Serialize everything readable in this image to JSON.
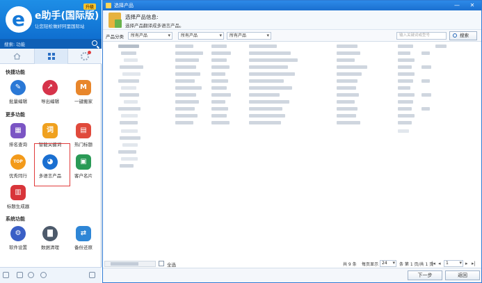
{
  "app": {
    "brand_title": "e助手(国际版)",
    "brand_badge": "升级",
    "brand_subtitle": "让您轻松做好阿里国际站",
    "search_text": "搜索: 功能"
  },
  "sections": {
    "quick": "快捷功能",
    "more": "更多功能",
    "system": "系统功能"
  },
  "tools": {
    "batch_edit": "批量编辑",
    "export_edit": "导出编辑",
    "one_click_move": "一键搬家",
    "rank_query": "排名查询",
    "smart_keywords": "智能关键词",
    "hot_titles": "热门标题",
    "premium_ranking": "优秀同行",
    "multilang_product": "多语言产品",
    "customer_cards": "客户名片",
    "title_generator": "标题生成器",
    "software_settings": "软件设置",
    "data_cleanup": "数据清理",
    "backup_restore": "备份还原"
  },
  "dialog": {
    "title": "选择产品",
    "info_title": "选择产品信息:",
    "info_desc": "选择产品翻译成多语言产品。",
    "filter_label": "产品分类",
    "filters": [
      "所有产品",
      "所有产品",
      "所有产品"
    ],
    "search_placeholder": "输入关键词或型号",
    "search_button": "搜索",
    "select_all": "全选",
    "pager": {
      "total": "共 9 条",
      "per_page_label": "每页显示",
      "per_page": "24",
      "page_info": "条  第 1 页/共 1 页",
      "page": "1"
    },
    "next_button": "下一步",
    "back_button": "返回"
  },
  "colors": {
    "brand_blue": "#1478d8",
    "highlight_red": "#e03a3a"
  }
}
